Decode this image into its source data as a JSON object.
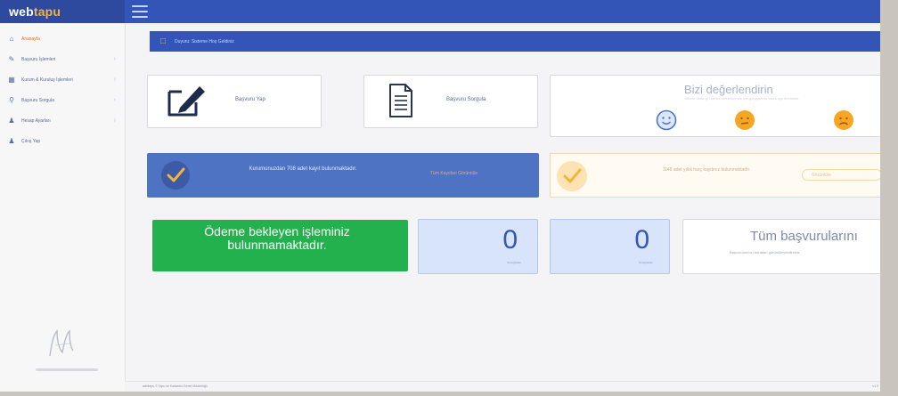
{
  "brand": {
    "logo_prefix": "web",
    "logo_suffix": "tapu"
  },
  "sidebar": {
    "items": [
      {
        "label": "Anasayfa",
        "icon": "home-icon",
        "active": true
      },
      {
        "label": "Başvuru İşlemleri",
        "icon": "edit-icon",
        "active": false
      },
      {
        "label": "Kurum & Kuruluş İşlemleri",
        "icon": "building-icon",
        "active": false
      },
      {
        "label": "Başvuru Sorgula",
        "icon": "search-icon",
        "active": false
      },
      {
        "label": "Hesap Ayarları",
        "icon": "user-icon",
        "active": false
      },
      {
        "label": "Çıkış Yap",
        "icon": "logout-icon",
        "active": false
      }
    ]
  },
  "banner": {
    "text": "Duyuru: Sisteme Hoş Geldiniz"
  },
  "cards": {
    "write": {
      "label": "Başvuru Yap"
    },
    "query": {
      "label": "Başvuru Sorgula"
    }
  },
  "rating": {
    "title": "Bizi değerlendirin",
    "subtitle": "Sizlere daha iyi hizmet verebilmemiz için görüşleriniz bizim için önemlidir."
  },
  "notices": {
    "blue_text": "Kurumunuzdan 708 adet kayıt bulunmaktadır.",
    "blue_link": "Tüm Kayıtları Görüntüle",
    "cream_text": "1148 adet yıllık harç kaydınız bulunmaktadır.",
    "cream_button": "Görüntüle"
  },
  "payment": {
    "text": "Ödeme bekleyen işleminiz bulunmamaktadır."
  },
  "stats": [
    {
      "value": "0",
      "label": "Sonuçlanan"
    },
    {
      "value": "0",
      "label": "Sonuçlanan"
    }
  ],
  "all_applications": {
    "title": "Tüm başvurularını",
    "subtitle": "Başvurularınızı buradan görüntüleyebilirsiniz"
  },
  "footer": {
    "text": "webtapu © Tapu ve Kadastro Genel Müdürlüğü",
    "right": "v1.0"
  },
  "colors": {
    "primary": "#3355b7",
    "green": "#22b14c",
    "accent_orange": "#e86a2c",
    "stat_bg": "#d7e4fa"
  }
}
